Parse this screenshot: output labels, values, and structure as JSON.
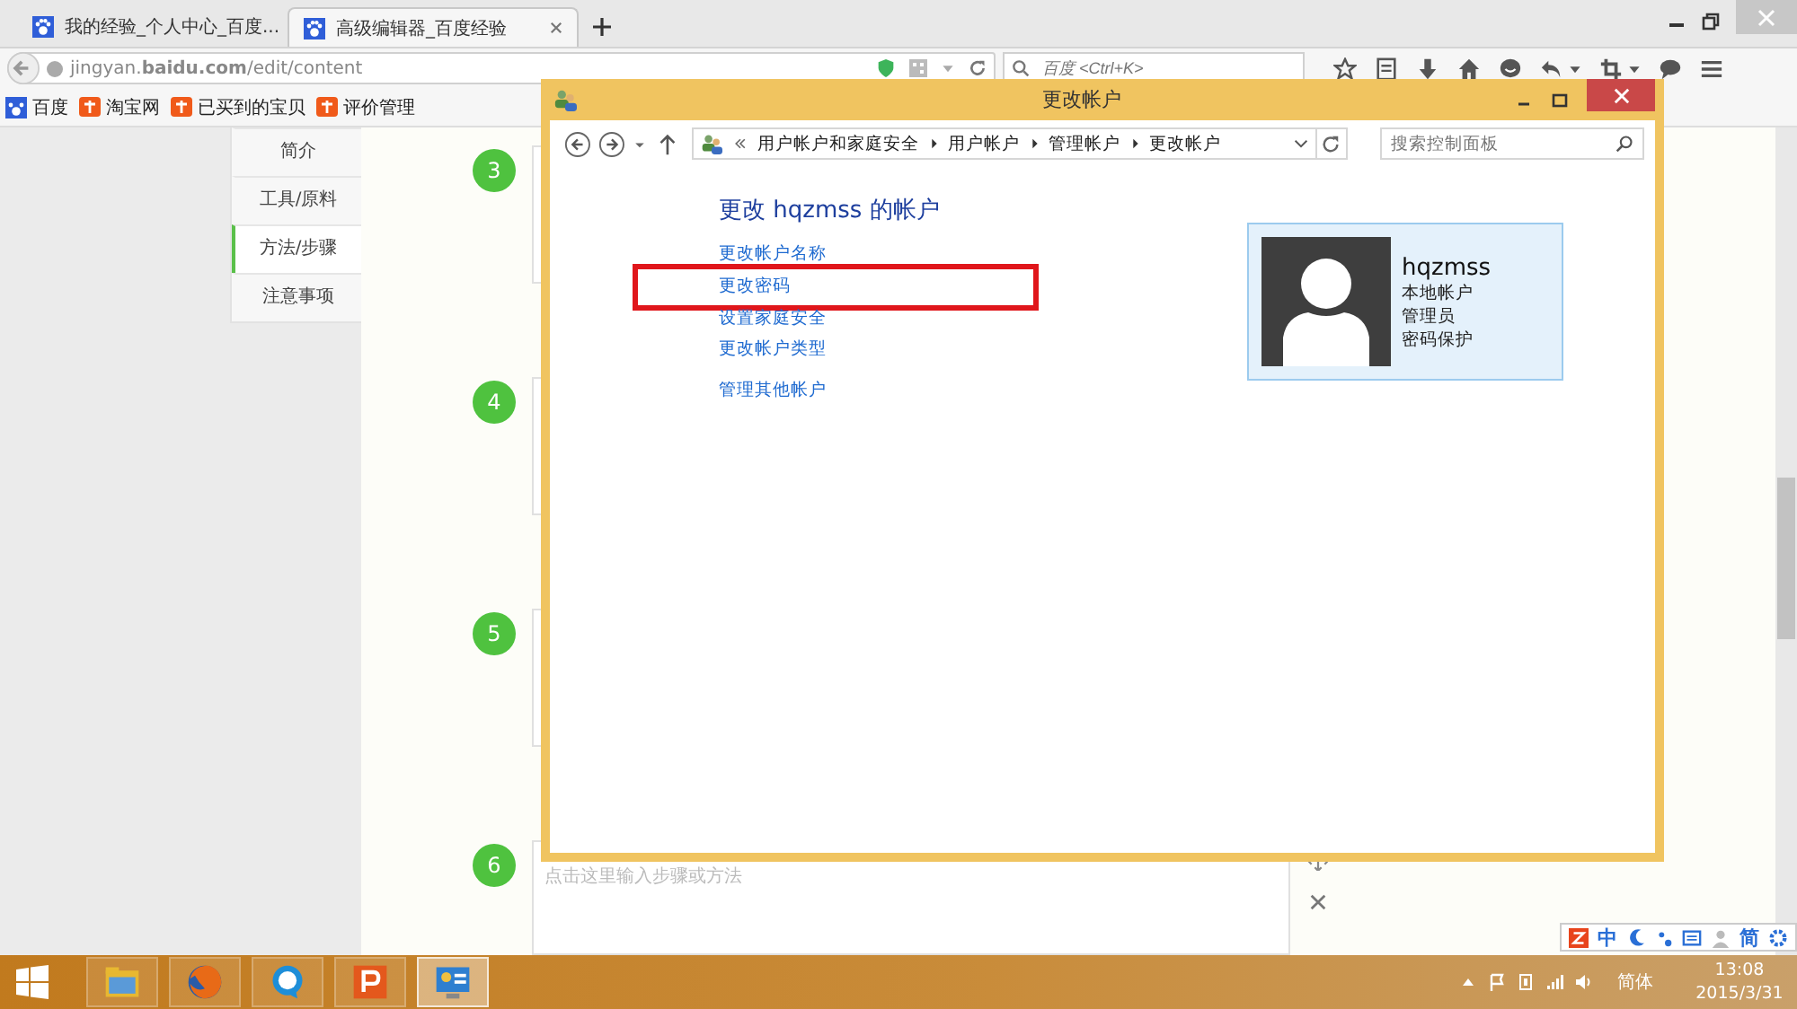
{
  "browser_tabs": [
    {
      "title": "我的经验_个人中心_百度...",
      "selected": false
    },
    {
      "title": "高级编辑器_百度经验",
      "selected": true
    }
  ],
  "address_bar": {
    "url": "jingyan.**baidu.com**/edit/content"
  },
  "search": {
    "placeholder": "百度 <Ctrl+K>"
  },
  "bookmarks": [
    {
      "label": "百度",
      "kind": "paw"
    },
    {
      "label": "淘宝网",
      "kind": "taobao"
    },
    {
      "label": "已买到的宝贝",
      "kind": "taobao"
    },
    {
      "label": "评价管理",
      "kind": "taobao"
    }
  ],
  "outline": [
    {
      "label": "简介",
      "selected": false
    },
    {
      "label": "工具/原料",
      "selected": false
    },
    {
      "label": "方法/步骤",
      "selected": true
    },
    {
      "label": "注意事项",
      "selected": false
    }
  ],
  "steps": [
    {
      "number": "3"
    },
    {
      "number": "4"
    },
    {
      "number": "5"
    },
    {
      "number": "6",
      "placeholder": "点击这里输入步骤或方法"
    }
  ],
  "dialog": {
    "title": "更改帐户",
    "breadcrumb": [
      "用户帐户和家庭安全",
      "用户帐户",
      "管理帐户",
      "更改帐户"
    ],
    "search_placeholder": "搜索控制面板",
    "heading": "更改 hqzmss 的帐户",
    "links": [
      {
        "label": "更改帐户名称",
        "highlighted": false
      },
      {
        "label": "更改密码",
        "highlighted": true
      },
      {
        "label": "设置家庭安全",
        "highlighted": false
      },
      {
        "label": "更改帐户类型",
        "highlighted": false
      }
    ],
    "other_link": "管理其他帐户",
    "account": {
      "name": "hqzmss",
      "details": [
        "本地帐户",
        "管理员",
        "密码保护"
      ]
    }
  },
  "ime": [
    "中",
    "简"
  ],
  "taskbar": {
    "apps": [
      {
        "kind": "folder",
        "selected": false
      },
      {
        "kind": "firefox",
        "selected": false
      },
      {
        "kind": "chat",
        "selected": false
      },
      {
        "kind": "slides",
        "selected": false
      },
      {
        "kind": "panel",
        "selected": true
      }
    ],
    "language": "简体",
    "time": "13:08",
    "date": "2015/3/31"
  }
}
